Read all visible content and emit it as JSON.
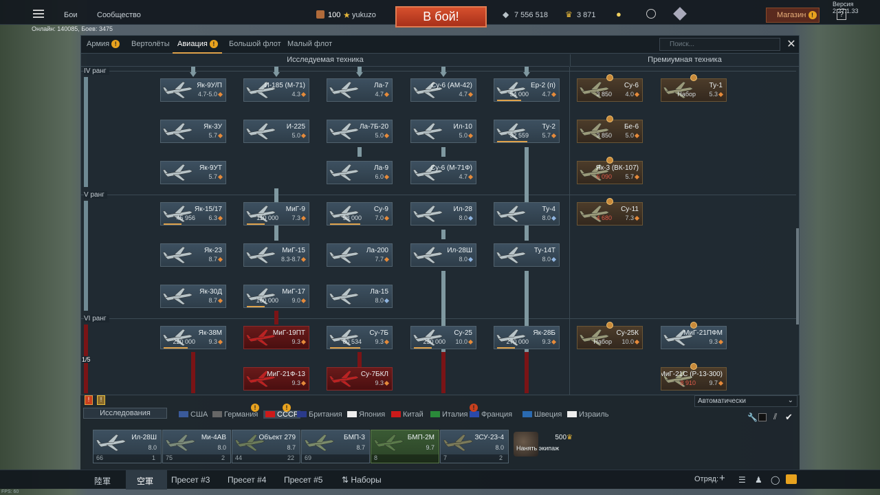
{
  "topbar": {
    "menu_battles": "Бои",
    "menu_community": "Сообщество",
    "online": "Онлайн: 140085, Боев: 3475",
    "player_level": "100",
    "player_name": "yukuzo",
    "battle_button": "В бой!",
    "silver_lions": "7 556 518",
    "gold_eagles": "3 871",
    "shop_label": "Магазин",
    "help": "?",
    "version": "Версия 2.27.1.33"
  },
  "tabs": [
    "Армия",
    "Вертолёты",
    "Авиация",
    "Большой флот",
    "Малый флот"
  ],
  "search_placeholder": "Поиск...",
  "sections": {
    "research": "Исследуемая техника",
    "premium": "Премиумная техника"
  },
  "ranks": [
    "IV ранг",
    "V ранг",
    "VI ранг"
  ],
  "rank_page": "1/5",
  "cards": [
    {
      "name": "Як-9У/П",
      "br": "4.7-5.0"
    },
    {
      "name": "И-185 (М-71)",
      "br": "4.3"
    },
    {
      "name": "Ла-7",
      "br": "4.7"
    },
    {
      "name": "Су-6 (АМ-42)",
      "br": "4.7"
    },
    {
      "name": "Ер-2 (п)",
      "br": "4.7",
      "cost": "54 000"
    },
    {
      "name": "Як-3У",
      "br": "5.7"
    },
    {
      "name": "И-225",
      "br": "5.0"
    },
    {
      "name": "Ла-7Б-20",
      "br": "5.0"
    },
    {
      "name": "Ил-10",
      "br": "5.0"
    },
    {
      "name": "Ту-2",
      "br": "5.7",
      "cost": "32 559"
    },
    {
      "name": "Як-9УТ",
      "br": "5.7"
    },
    {
      "name": "Ла-9",
      "br": "6.0"
    },
    {
      "name": "Су-6 (М-71Ф)",
      "br": "4.7"
    },
    {
      "name": "Як-15/17",
      "br": "6.3",
      "cost": "45 956"
    },
    {
      "name": "МиГ-9",
      "br": "7.3",
      "cost": "110 000"
    },
    {
      "name": "Су-9",
      "br": "7.0",
      "cost": "98 000"
    },
    {
      "name": "Ил-28",
      "br": "8.0"
    },
    {
      "name": "Ту-4",
      "br": "8.0"
    },
    {
      "name": "Як-23",
      "br": "8.7"
    },
    {
      "name": "МиГ-15",
      "br": "8.3-8.7"
    },
    {
      "name": "Ла-200",
      "br": "7.7"
    },
    {
      "name": "Ил-28Ш",
      "br": "8.0"
    },
    {
      "name": "Ту-14Т",
      "br": "8.0"
    },
    {
      "name": "Як-30Д",
      "br": "8.7"
    },
    {
      "name": "МиГ-17",
      "br": "9.0",
      "cost": "160 000"
    },
    {
      "name": "Ла-15",
      "br": "8.0"
    },
    {
      "name": "Як-38М",
      "br": "9.3",
      "cost": "220 000"
    },
    {
      "name": "МиГ-19ПТ",
      "br": "9.3"
    },
    {
      "name": "Су-7Б",
      "br": "9.3",
      "cost": "80 534"
    },
    {
      "name": "Су-25",
      "br": "10.0",
      "cost": "230 000"
    },
    {
      "name": "Як-28Б",
      "br": "9.3",
      "cost": "270 000"
    },
    {
      "name": "МиГ-21Ф-13",
      "br": "9.3"
    },
    {
      "name": "Су-7БКЛ",
      "br": "9.3"
    }
  ],
  "premium_cards": [
    {
      "name": "Су-6",
      "br": "4.0",
      "cost": "3 850"
    },
    {
      "name": "Ту-1",
      "br": "5.3",
      "cost": "Набор"
    },
    {
      "name": "Бе-6",
      "br": "5.0",
      "cost": "3 850"
    },
    {
      "name": "Як-3 (ВК-107)",
      "br": "5.7",
      "cost": "6 090"
    },
    {
      "name": "Су-11",
      "br": "7.3",
      "cost": "4 680"
    },
    {
      "name": "Су-25К",
      "br": "10.0",
      "cost": "Набор"
    },
    {
      "name": "МиГ-21ПФМ",
      "br": "9.3"
    },
    {
      "name": "МиГ-21С (Р-13-300)",
      "br": "9.7",
      "cost": "8 910"
    }
  ],
  "research_dropdown": "Исследования",
  "auto_dropdown": "Автоматически",
  "nations": [
    "США",
    "Германия",
    "СССР",
    "Британия",
    "Япония",
    "Китай",
    "Италия",
    "Франция",
    "Швеция",
    "Израиль"
  ],
  "crew": [
    {
      "name": "Ил-28Ш",
      "br": "8.0",
      "left": "66",
      "right": "1"
    },
    {
      "name": "Ми-4АВ",
      "br": "8.0",
      "left": "75",
      "right": "2"
    },
    {
      "name": "Объект 279",
      "br": "8.7",
      "left": "44",
      "right": "22"
    },
    {
      "name": "БМП-3",
      "br": "8.7",
      "left": "69",
      "right": ""
    },
    {
      "name": "БМП-2М",
      "br": "9.7",
      "left": "8",
      "right": ""
    },
    {
      "name": "ЗСУ-23-4",
      "br": "8.0",
      "left": "7",
      "right": "2"
    }
  ],
  "hire_crew": {
    "cost": "500",
    "label": "Нанять экипаж"
  },
  "footer": {
    "preset_active": "空軍",
    "preset_army": "陸軍",
    "presets": [
      "Пресет #3",
      "Пресет #4",
      "Пресет #5"
    ],
    "sets": "Наборы",
    "squad": "Отряд:",
    "fps": "FPS: 60"
  }
}
